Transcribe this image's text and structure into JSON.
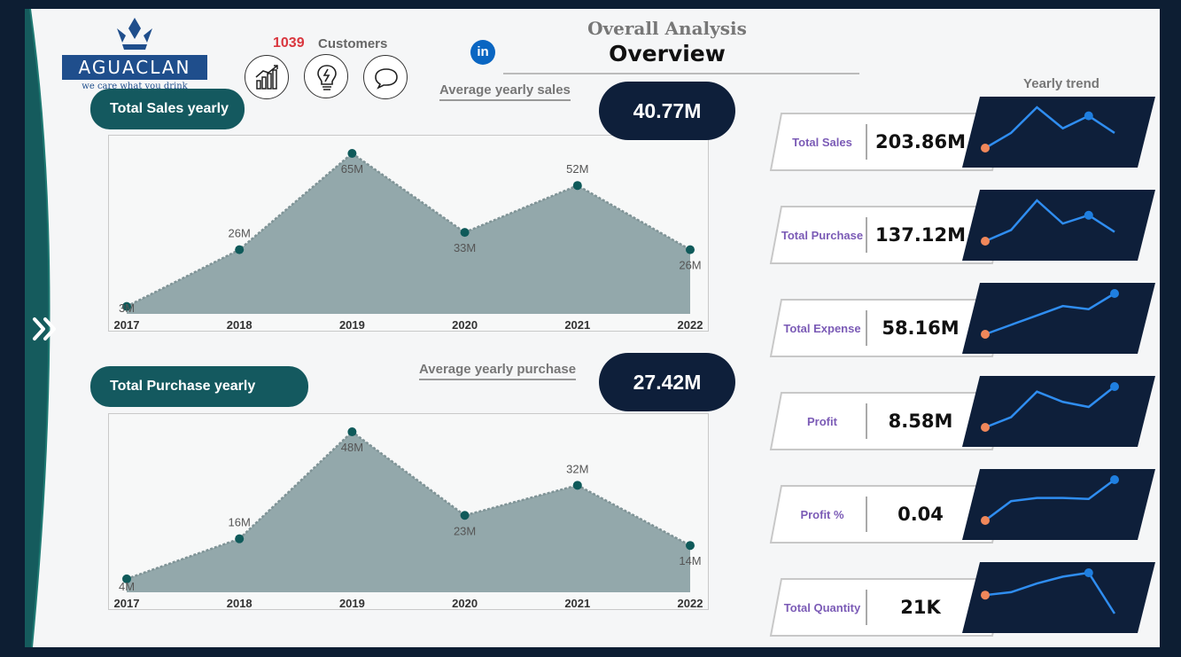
{
  "brand": {
    "name": "AGUACLAN",
    "tagline": "we care what you drink"
  },
  "customers": {
    "count": "1039",
    "label": "Customers"
  },
  "header": {
    "title": "Overall Analysis",
    "subtitle": "Overview"
  },
  "icons": {
    "expand": "double-chevron-right-icon",
    "nav1": "growth-chart-icon",
    "nav2": "lightbulb-icon",
    "nav3": "chat-bubble-icon",
    "social": "linkedin-icon"
  },
  "linkedin_text": "in",
  "sales_panel": {
    "pill": "Total Sales yearly",
    "avg_label": "Average yearly sales",
    "avg_value": "40.77M"
  },
  "purchase_panel": {
    "pill": "Total Purchase yearly",
    "avg_label": "Average yearly purchase",
    "avg_value": "27.42M"
  },
  "yearly_trend_title": "Yearly trend",
  "kpis": [
    {
      "name": "Total Sales",
      "value": "203.86M"
    },
    {
      "name": "Total Purchase",
      "value": "137.12M"
    },
    {
      "name": "Total Expense",
      "value": "58.16M"
    },
    {
      "name": "Profit",
      "value": "8.58M"
    },
    {
      "name": "Profit %",
      "value": "0.04"
    },
    {
      "name": "Total Quantity",
      "value": "21K"
    }
  ],
  "colors": {
    "frame_bg": "#0d1e33",
    "area_fill": "#93a8ab",
    "point": "#0f5a5a",
    "pill": "#14595f",
    "kpi_dark": "#0e1f3a",
    "spark_line": "#2f8df0",
    "spark_start": "#f0875a",
    "count_red": "#d9363e",
    "kpi_label": "#7b5bb6"
  },
  "chart_data": [
    {
      "type": "area",
      "title": "Total Sales yearly",
      "categories": [
        "2017",
        "2018",
        "2019",
        "2020",
        "2021",
        "2022"
      ],
      "values": [
        3,
        26,
        65,
        33,
        52,
        26
      ],
      "labels": [
        "3M",
        "26M",
        "65M",
        "33M",
        "52M",
        "26M"
      ],
      "ylim": [
        0,
        65
      ]
    },
    {
      "type": "area",
      "title": "Total Purchase yearly",
      "categories": [
        "2017",
        "2018",
        "2019",
        "2020",
        "2021",
        "2022"
      ],
      "values": [
        4,
        16,
        48,
        23,
        32,
        14
      ],
      "labels": [
        "4M",
        "16M",
        "48M",
        "23M",
        "32M",
        "14M"
      ],
      "ylim": [
        0,
        48
      ]
    },
    {
      "type": "line",
      "title": "Yearly trend",
      "series": [
        {
          "values": [
            3,
            26,
            65,
            33,
            52,
            26
          ]
        },
        {
          "values": [
            4,
            16,
            48,
            23,
            32,
            14
          ]
        },
        {
          "values": [
            3,
            6,
            9,
            12,
            11,
            16
          ]
        },
        {
          "values": [
            1,
            2,
            4.5,
            3.5,
            3,
            5
          ]
        },
        {
          "values": [
            0.1,
            0.28,
            0.31,
            0.31,
            0.3,
            0.48
          ]
        },
        {
          "values": [
            1,
            1.3,
            2.2,
            2.9,
            3.3,
            -0.9
          ]
        }
      ]
    }
  ]
}
